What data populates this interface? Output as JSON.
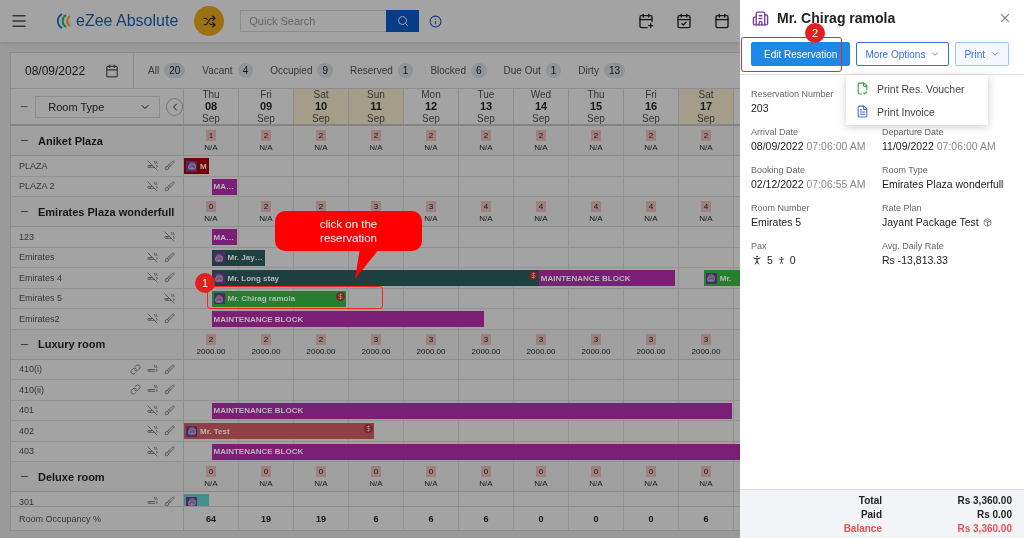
{
  "topbar": {
    "logo": "eZee Absolute",
    "search": {
      "placeholder": "Quick Search"
    }
  },
  "filters": {
    "date": "08/09/2022",
    "chips": [
      {
        "label": "All",
        "count": "20"
      },
      {
        "label": "Vacant",
        "count": "4"
      },
      {
        "label": "Occupied",
        "count": "9"
      },
      {
        "label": "Reserved",
        "count": "1"
      },
      {
        "label": "Blocked",
        "count": "6"
      },
      {
        "label": "Due Out",
        "count": "1"
      },
      {
        "label": "Dirty",
        "count": "13"
      }
    ]
  },
  "room_type_select": {
    "value": "Room Type"
  },
  "days": [
    {
      "weekday": "Thu",
      "day": "08",
      "month": "Sep",
      "weekend": false
    },
    {
      "weekday": "Fri",
      "day": "09",
      "month": "Sep",
      "weekend": false
    },
    {
      "weekday": "Sat",
      "day": "10",
      "month": "Sep",
      "weekend": true
    },
    {
      "weekday": "Sun",
      "day": "11",
      "month": "Sep",
      "weekend": true
    },
    {
      "weekday": "Mon",
      "day": "12",
      "month": "Sep",
      "weekend": false
    },
    {
      "weekday": "Tue",
      "day": "13",
      "month": "Sep",
      "weekend": false
    },
    {
      "weekday": "Wed",
      "day": "14",
      "month": "Sep",
      "weekend": false
    },
    {
      "weekday": "Thu",
      "day": "15",
      "month": "Sep",
      "weekend": false
    },
    {
      "weekday": "Fri",
      "day": "16",
      "month": "Sep",
      "weekend": false
    },
    {
      "weekday": "Sat",
      "day": "17",
      "month": "Sep",
      "weekend": true
    }
  ],
  "groups": [
    {
      "name": "Aniket Plaza",
      "cells": [
        {
          "count": "1",
          "rate": "N/A"
        },
        {
          "count": "2",
          "rate": "N/A"
        },
        {
          "count": "2",
          "rate": "N/A"
        },
        {
          "count": "2",
          "rate": "N/A"
        },
        {
          "count": "2",
          "rate": "N/A"
        },
        {
          "count": "2",
          "rate": "N/A"
        },
        {
          "count": "2",
          "rate": "N/A"
        },
        {
          "count": "2",
          "rate": "N/A"
        },
        {
          "count": "2",
          "rate": "N/A"
        },
        {
          "count": "2",
          "rate": "N/A"
        }
      ],
      "rooms": [
        {
          "name": "PLAZA",
          "linked": false,
          "smoking": false,
          "housekeeping": true,
          "bars": [
            {
              "kind": "reservation",
              "label": "M",
              "color": "#760000"
            }
          ]
        },
        {
          "name": "PLAZA 2",
          "linked": false,
          "smoking": false,
          "housekeeping": true,
          "bars": [
            {
              "kind": "block",
              "label": "MA…",
              "color": "#7b1e75"
            }
          ]
        }
      ]
    },
    {
      "name": "Emirates Plaza wonderfull",
      "cells": [
        {
          "count": "0",
          "rate": "N/A"
        },
        {
          "count": "2",
          "rate": "N/A"
        },
        {
          "count": "2"
        },
        {
          "count": "3"
        },
        {
          "count": "3",
          "rate": "N/A"
        },
        {
          "count": "4",
          "rate": "N/A"
        },
        {
          "count": "4",
          "rate": "N/A"
        },
        {
          "count": "4",
          "rate": "N/A"
        },
        {
          "count": "4",
          "rate": "N/A"
        },
        {
          "count": "4",
          "rate": "N/A"
        }
      ],
      "rooms": [
        {
          "name": "123",
          "linked": false,
          "smoking": false,
          "housekeeping": false,
          "bars": [
            {
              "kind": "block",
              "label": "MA…",
              "color": "#7b1e75"
            }
          ]
        },
        {
          "name": "Emirates",
          "linked": false,
          "smoking": false,
          "housekeeping": true,
          "bars": [
            {
              "kind": "reservation",
              "label": "Mr. Jay…",
              "color": "#1e3f3f"
            }
          ]
        },
        {
          "name": "Emirates 4",
          "linked": false,
          "smoking": false,
          "housekeeping": true,
          "bars": [
            {
              "kind": "reservation",
              "label": "Mr. Long stay",
              "color": "#1e3f3f",
              "payment_due": true
            },
            {
              "kind": "block",
              "label": "MAINTENANCE BLOCK",
              "color": "#7b1e75"
            },
            {
              "kind": "reservation",
              "label": "Mr.",
              "color": "#24802d"
            }
          ]
        },
        {
          "name": "Emirates 5",
          "linked": false,
          "smoking": false,
          "housekeeping": false,
          "bars": [
            {
              "kind": "reservation",
              "label": "Mr. Chirag ramola",
              "color": "#24802d",
              "payment_due": true
            }
          ]
        },
        {
          "name": "Emirates2",
          "linked": false,
          "smoking": false,
          "housekeeping": true,
          "bars": [
            {
              "kind": "block",
              "label": "MAINTENANCE BLOCK",
              "color": "#7b1e75"
            }
          ]
        }
      ]
    },
    {
      "name": "Luxury room",
      "cells": [
        {
          "count": "2",
          "rate": "2000.00"
        },
        {
          "count": "2",
          "rate": "2000.00"
        },
        {
          "count": "2",
          "rate": "2000.00"
        },
        {
          "count": "3",
          "rate": "2000.00"
        },
        {
          "count": "3",
          "rate": "2000.00"
        },
        {
          "count": "3",
          "rate": "2000.00"
        },
        {
          "count": "3",
          "rate": "2000.00"
        },
        {
          "count": "3",
          "rate": "2000.00"
        },
        {
          "count": "3",
          "rate": "2000.00"
        },
        {
          "count": "3",
          "rate": "2000.00"
        }
      ],
      "rooms": [
        {
          "name": "410(i)",
          "linked": true,
          "smoking": true,
          "housekeeping": true
        },
        {
          "name": "410(ii)",
          "linked": true,
          "smoking": true,
          "housekeeping": true
        },
        {
          "name": "401",
          "linked": false,
          "smoking": false,
          "housekeeping": true,
          "bars": [
            {
              "kind": "block",
              "label": "MAINTENANCE BLOCK",
              "color": "#7b1e75"
            }
          ]
        },
        {
          "name": "402",
          "linked": false,
          "smoking": false,
          "housekeeping": true,
          "bars": [
            {
              "kind": "reservation",
              "label": "Mr. Test",
              "color": "#8f4040",
              "payment_due": true
            }
          ]
        },
        {
          "name": "403",
          "linked": false,
          "smoking": false,
          "housekeeping": true,
          "bars": [
            {
              "kind": "block",
              "label": "MAINTENANCE BLOCK",
              "color": "#7b1e75"
            }
          ]
        }
      ]
    },
    {
      "name": "Deluxe room",
      "cells": [
        {
          "count": "0",
          "rate": "N/A"
        },
        {
          "count": "0",
          "rate": "N/A"
        },
        {
          "count": "0",
          "rate": "N/A"
        },
        {
          "count": "0",
          "rate": "N/A"
        },
        {
          "count": "0",
          "rate": "N/A"
        },
        {
          "count": "0",
          "rate": "N/A"
        },
        {
          "count": "0",
          "rate": "N/A"
        },
        {
          "count": "0",
          "rate": "N/A"
        },
        {
          "count": "0",
          "rate": "N/A"
        },
        {
          "count": "0",
          "rate": "N/A"
        }
      ],
      "rooms": [
        {
          "name": "301",
          "linked": false,
          "smoking": true,
          "housekeeping": true,
          "bars": [
            {
              "kind": "reservation",
              "color": "#448f8f"
            }
          ]
        }
      ]
    }
  ],
  "occupancy": {
    "label": "Room Occupancy %",
    "values": [
      "64",
      "19",
      "19",
      "6",
      "6",
      "6",
      "0",
      "0",
      "0",
      "6"
    ]
  },
  "panel": {
    "title": "Mr. Chirag ramola",
    "buttons": [
      {
        "kind": "primary",
        "label": "Edit Reservation"
      },
      {
        "kind": "dropdown",
        "label": "More Options",
        "expanded": false
      },
      {
        "kind": "dropdown",
        "label": "Print",
        "expanded": true
      }
    ],
    "print_menu": [
      {
        "kind": "voucher",
        "label": "Print Res. Voucher"
      },
      {
        "kind": "invoice",
        "label": "Print Invoice"
      }
    ],
    "fields": [
      {
        "label": "Reservation Number",
        "value": "203"
      },
      {
        "kind": "blank"
      },
      {
        "label": "Arrival Date",
        "value": "08/09/2022",
        "time": "07:06:00 AM"
      },
      {
        "label": "Departure Date",
        "value": "11/09/2022",
        "time": "07:06:00 AM"
      },
      {
        "label": "Booking Date",
        "value": "02/12/2022",
        "time": "07:06:55 AM"
      },
      {
        "label": "Room Type",
        "value": "Emirates Plaza wonderfull"
      },
      {
        "label": "Room Number",
        "value": "Emirates 5"
      },
      {
        "label": "Rate Plan",
        "value": "Jayant Package Test",
        "kind": "package"
      },
      {
        "label": "Pax",
        "kind": "pax",
        "adults": "5",
        "children": "0"
      },
      {
        "label": "Avg. Daily Rate",
        "value": "Rs -13,813.33"
      }
    ],
    "totals": [
      {
        "label": "Total",
        "value": "Rs 3,360.00",
        "alert": false
      },
      {
        "label": "Paid",
        "value": "Rs 0.00",
        "alert": false
      },
      {
        "label": "Balance",
        "value": "Rs 3,360.00",
        "alert": true
      }
    ]
  },
  "annotations": [
    {
      "kind": "callout",
      "text": "click on the reservation"
    },
    {
      "kind": "step",
      "text": "1"
    },
    {
      "kind": "step",
      "text": "2"
    }
  ]
}
